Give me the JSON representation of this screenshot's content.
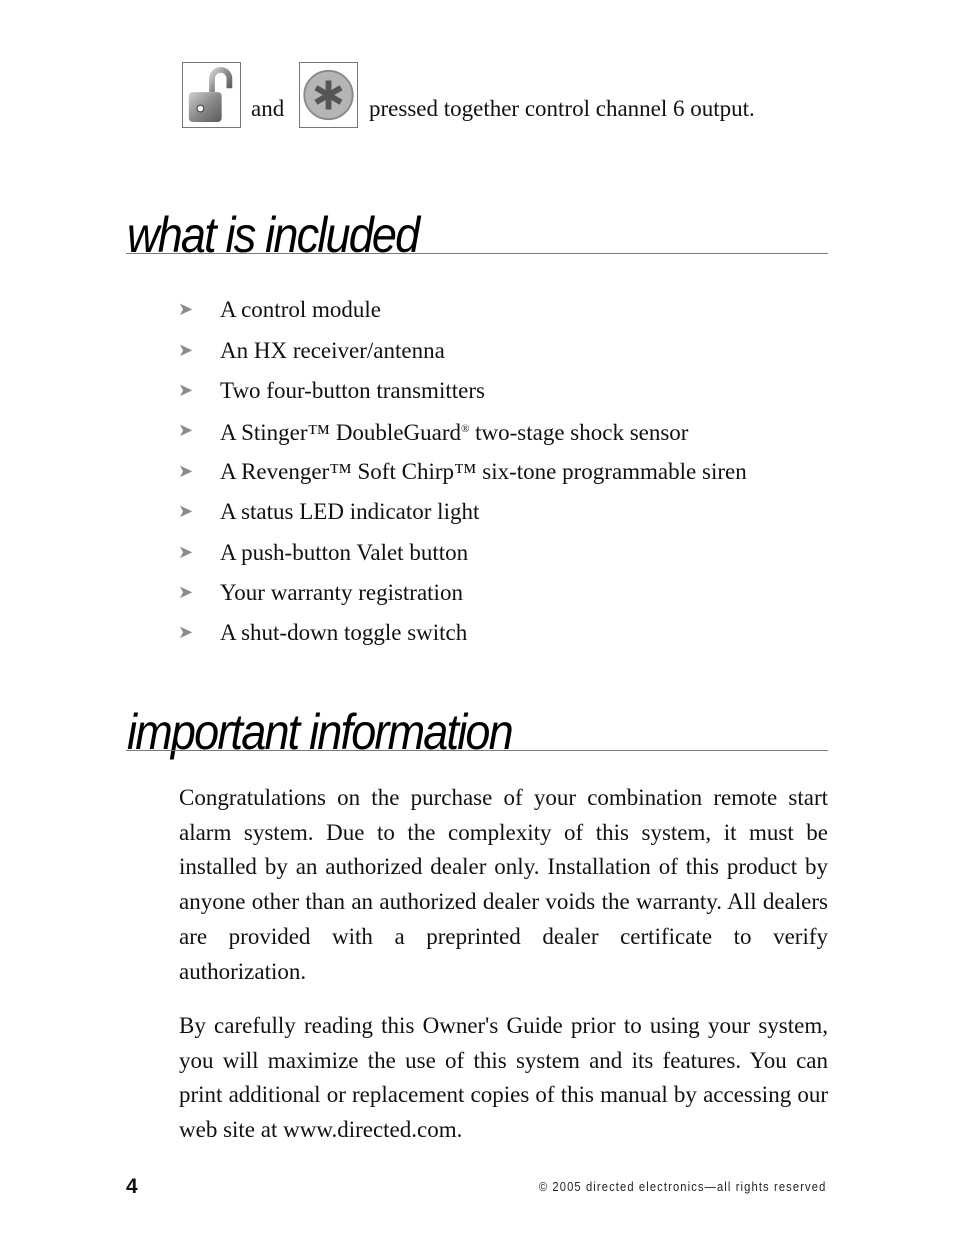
{
  "top_line": {
    "icon1": "unlock-icon",
    "connector": "and",
    "icon2": "asterisk-button-icon",
    "text": "pressed together control channel 6 output."
  },
  "sections": [
    {
      "heading": "what is included",
      "items": [
        {
          "bullet": "➤",
          "text": "A control module"
        },
        {
          "bullet": "➤",
          "text": "An HX receiver/antenna"
        },
        {
          "bullet": "➤",
          "text": "Two four-button transmitters"
        },
        {
          "bullet": "➤",
          "text_a": "A Stinger™ DoubleGuard",
          "sup": "®",
          "text_b": " two-stage shock sensor"
        },
        {
          "bullet": "➤",
          "text": "A Revenger™ Soft Chirp™ six-tone programmable siren"
        },
        {
          "bullet": "➤",
          "text": "A status LED indicator light"
        },
        {
          "bullet": "➤",
          "text": "A push-button Valet button"
        },
        {
          "bullet": "➤",
          "text": "Your warranty registration"
        },
        {
          "bullet": "➤",
          "text": "A shut-down toggle switch"
        }
      ]
    },
    {
      "heading": "important information",
      "paragraphs": [
        "Congratulations on the purchase of your combination remote start alarm system. Due to the complexity of this system, it must be installed by an authorized dealer only. Installation of this product by anyone other than an authorized dealer voids the warranty. All dealers are provided with a preprinted dealer certifi­cate to verify authorization.",
        "By carefully reading this Owner's Guide prior to using your system, you will maximize the use of this system and its features. You can print additional or replacement copies of this manual by accessing our web site at www.directed.com."
      ]
    }
  ],
  "footer": {
    "page_number": "4",
    "copyright": "© 2005 directed electronics—all rights reserved"
  }
}
